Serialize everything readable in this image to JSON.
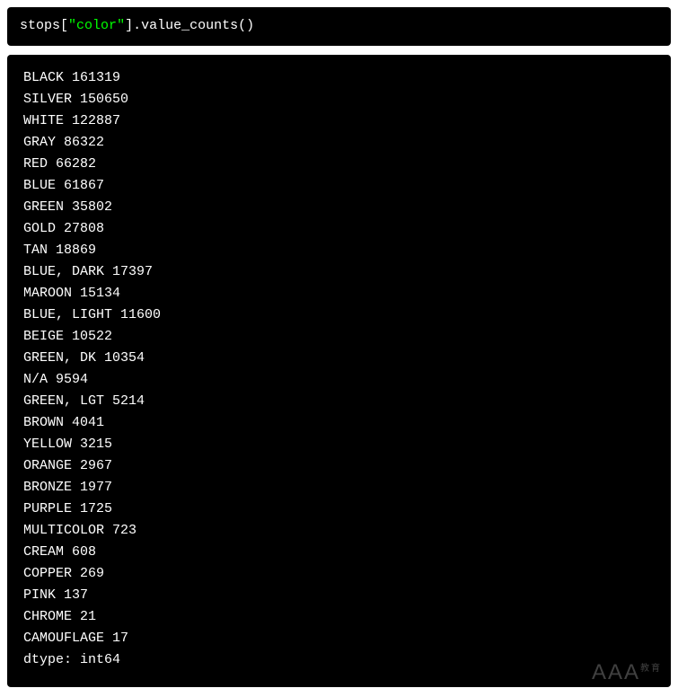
{
  "code": {
    "var": "stops",
    "open_bracket": "[",
    "str_quote_open": "\"",
    "str_value": "color",
    "str_quote_close": "\"",
    "close_bracket": "]",
    "dot": ".",
    "method": "value_counts",
    "parens": "()"
  },
  "output": {
    "rows": [
      {
        "label": "BLACK",
        "count": "161319"
      },
      {
        "label": "SILVER",
        "count": "150650"
      },
      {
        "label": "WHITE",
        "count": "122887"
      },
      {
        "label": "GRAY",
        "count": "86322"
      },
      {
        "label": "RED",
        "count": "66282"
      },
      {
        "label": "BLUE",
        "count": "61867"
      },
      {
        "label": "GREEN",
        "count": "35802"
      },
      {
        "label": "GOLD",
        "count": "27808"
      },
      {
        "label": "TAN",
        "count": "18869"
      },
      {
        "label": "BLUE, DARK",
        "count": "17397"
      },
      {
        "label": "MAROON",
        "count": "15134"
      },
      {
        "label": "BLUE, LIGHT",
        "count": "11600"
      },
      {
        "label": "BEIGE",
        "count": "10522"
      },
      {
        "label": "GREEN, DK",
        "count": "10354"
      },
      {
        "label": "N/A",
        "count": "9594"
      },
      {
        "label": "GREEN, LGT",
        "count": "5214"
      },
      {
        "label": "BROWN",
        "count": "4041"
      },
      {
        "label": "YELLOW",
        "count": "3215"
      },
      {
        "label": "ORANGE",
        "count": "2967"
      },
      {
        "label": "BRONZE",
        "count": "1977"
      },
      {
        "label": "PURPLE",
        "count": "1725"
      },
      {
        "label": "MULTICOLOR",
        "count": "723"
      },
      {
        "label": "CREAM",
        "count": "608"
      },
      {
        "label": "COPPER",
        "count": "269"
      },
      {
        "label": "PINK",
        "count": "137"
      },
      {
        "label": "CHROME",
        "count": "21"
      },
      {
        "label": "CAMOUFLAGE",
        "count": "17"
      }
    ],
    "dtype_line": "dtype: int64"
  },
  "watermark": {
    "text": "AAA",
    "suffix": "教育"
  }
}
